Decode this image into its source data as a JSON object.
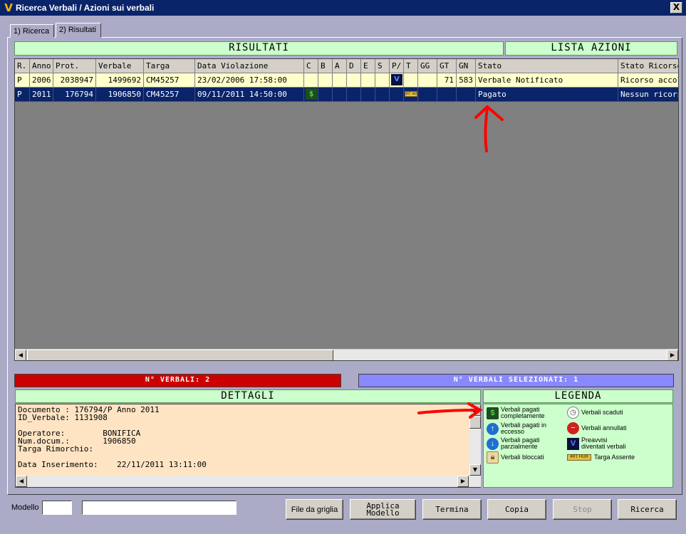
{
  "window": {
    "title": "Ricerca Verbali / Azioni sui verbali",
    "close": "X",
    "app_icon": "V"
  },
  "tabs": [
    {
      "label": "1) Ricerca"
    },
    {
      "label": "2) Risultati"
    }
  ],
  "headers": {
    "risultati": "RISULTATI",
    "lista_azioni": "LISTA AZIONI",
    "dettagli": "DETTAGLI",
    "legenda": "LEGENDA"
  },
  "grid": {
    "columns": [
      "R.",
      "Anno",
      "Prot.",
      "Verbale",
      "Targa",
      "Data Violazione",
      "C",
      "B",
      "A",
      "D",
      "E",
      "S",
      "P/",
      "T",
      "GG",
      "GT",
      "GN",
      "Stato",
      "Stato Ricorso"
    ],
    "rows": [
      {
        "r": "P",
        "anno": "2006",
        "prot": "2038947",
        "verbale": "1499692",
        "targa": "CM45257",
        "data": "23/02/2006 17:58:00",
        "gg": "",
        "gt": "71",
        "gn": "583",
        "stato": "Verbale Notificato",
        "stato_ricorso": "Ricorso accolto",
        "icon_p": "V"
      },
      {
        "r": "P",
        "anno": "2011",
        "prot": "176794",
        "verbale": "1906850",
        "targa": "CM45257",
        "data": "09/11/2011 14:50:00",
        "gg": "",
        "gt": "",
        "gn": "",
        "stato": "Pagato",
        "stato_ricorso": "Nessun ricorso",
        "icon_t": "4RT HUR"
      }
    ]
  },
  "counts": {
    "verbali": "N° VERBALI: 2",
    "selezionati": "N° VERBALI SELEZIONATI: 1"
  },
  "details": {
    "lines": [
      "Documento : 176794/P Anno 2011",
      "ID_Verbale: 1131908",
      "",
      "Operatore:        BONIFICA",
      "Num.docum.:       1906850",
      "Targa Rimorchio:",
      "",
      "Data Inserimento:    22/11/2011 13:11:00"
    ]
  },
  "legend": [
    {
      "icon": "paid-icon",
      "label": "Verbali pagati completamente"
    },
    {
      "icon": "overpaid-icon",
      "label": "Verbali pagati in eccesso"
    },
    {
      "icon": "partial-paid-icon",
      "label": "Verbali pagati parzialmente"
    },
    {
      "icon": "lock-icon",
      "label": "Verbali bloccati"
    },
    {
      "icon": "clock-icon",
      "label": "Verbali scaduti"
    },
    {
      "icon": "cancel-icon",
      "label": "Verbali annullati"
    },
    {
      "icon": "v-icon",
      "label": "Preavvisi diventati verbali"
    },
    {
      "icon": "plate-icon",
      "label": "Targa Assente",
      "plate": "4RT HUR"
    }
  ],
  "footer": {
    "modello_label": "Modello",
    "modello_code": "",
    "modello_name": "",
    "buttons": {
      "file": "File da griglia",
      "applica_1": "Applica",
      "applica_2": "Modello",
      "termina": "Termina",
      "copia": "Copia",
      "stop": "Stop",
      "ricerca": "Ricerca"
    }
  },
  "colors": {
    "title_bar": "#0A246A",
    "header_green": "#CCFFCC",
    "count_red": "#CC0000",
    "selected_blue": "#8888FF",
    "row_highlight": "#FFFFCC",
    "row_selected": "#0A246A",
    "details_bg": "#FFE4C4",
    "annotation": "#FF0000"
  }
}
